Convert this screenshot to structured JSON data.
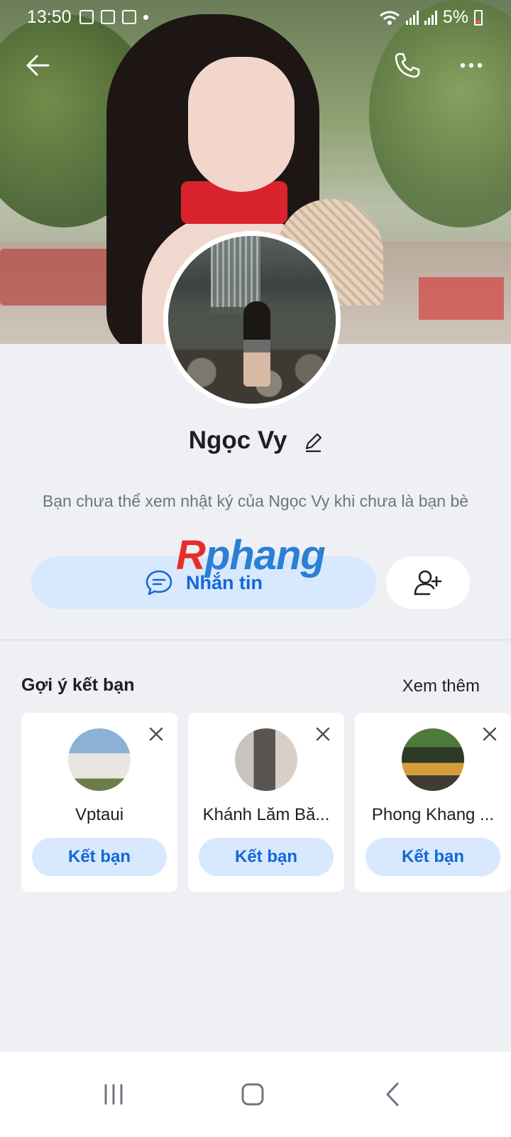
{
  "status_bar": {
    "time": "13:50",
    "battery": "5%"
  },
  "profile": {
    "name": "Ngọc Vy",
    "note": "Bạn chưa thể xem nhật ký của Ngọc Vy khi chưa là bạn bè"
  },
  "actions": {
    "message_label": "Nhắn tin"
  },
  "watermark": {
    "part1": "R",
    "part2": "phang"
  },
  "suggestions": {
    "title": "Gợi ý kết bạn",
    "see_more": "Xem thêm",
    "items": [
      {
        "name": "Vptaui",
        "button": "Kết bạn"
      },
      {
        "name": "Khánh Lăm Bă...",
        "button": "Kết bạn"
      },
      {
        "name": "Phong Khang ...",
        "button": "Kết bạn"
      }
    ]
  },
  "colors": {
    "accent": "#1466d9",
    "accent_bg": "#d8e9fd",
    "page_bg": "#eef0f4"
  }
}
